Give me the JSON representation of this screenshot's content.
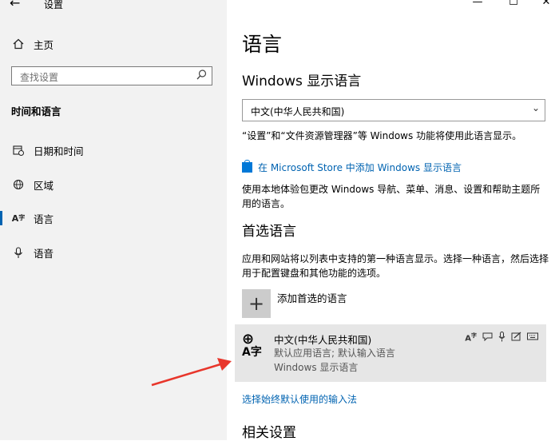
{
  "window": {
    "title": "设置",
    "minimize": "—",
    "maximize": "☐",
    "close": "✕"
  },
  "sidebar": {
    "home": "主页",
    "search_placeholder": "查找设置",
    "section_title": "时间和语言",
    "items": [
      {
        "label": "日期和时间",
        "icon": "calendar-clock-icon"
      },
      {
        "label": "区域",
        "icon": "globe-region-icon"
      },
      {
        "label": "语言",
        "icon": "language-icon"
      },
      {
        "label": "语音",
        "icon": "microphone-icon"
      }
    ],
    "selected_index": 2
  },
  "main": {
    "title": "语言",
    "display_lang_heading": "Windows 显示语言",
    "display_lang_value": "中文(中华人民共和国)",
    "display_lang_note": "“设置”和“文件资源管理器”等 Windows 功能将使用此语言显示。",
    "store_link": "在 Microsoft Store 中添加 Windows 显示语言",
    "store_note": "使用本地体验包更改 Windows 导航、菜单、消息、设置和帮助主题所用的语言。",
    "preferred_heading": "首选语言",
    "preferred_note": "应用和网站将以列表中支持的第一种语言显示。选择一种语言，然后选择用于配置键盘和其他功能的选项。",
    "add_label": "添加首选的语言",
    "language": {
      "name": "中文(中华人民共和国)",
      "line1": "默认应用语言; 默认输入语言",
      "line2": "Windows 显示语言",
      "glyph_top": "⊕",
      "glyph_bottom": "A字"
    },
    "input_method_link": "选择始终默认使用的输入法",
    "related_heading": "相关设置"
  },
  "colors": {
    "accent": "#0063b1",
    "arrow": "#e8362b"
  }
}
